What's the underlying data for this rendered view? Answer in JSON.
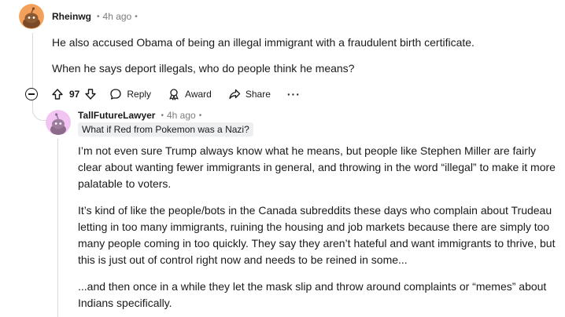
{
  "comment": {
    "author": "Rheinwg",
    "time": "4h ago",
    "paragraphs": [
      "He also accused Obama of being an illegal immigrant with a fraudulent birth certificate.",
      "When he says deport illegals, who do people think he means?"
    ],
    "votes": "97",
    "actions": {
      "reply": "Reply",
      "award": "Award",
      "share": "Share",
      "more": "···"
    }
  },
  "reply": {
    "author": "TallFutureLawyer",
    "time": "4h ago",
    "flair": "What if Red from Pokemon was a Nazi?",
    "paragraphs": [
      "I’m not even sure Trump always know what he means, but people like Stephen Miller are fairly clear about wanting fewer immigrants in general, and throwing in the word “illegal” to make it more palatable to voters.",
      "It’s kind of like the people/bots in the Canada subreddits these days who complain about Trudeau letting in too many immigrants, ruining the housing and job markets because there are simply too many people coming in too quickly. They say they aren’t hateful and want immigrants to thrive, but this is just out of control right now and needs to be reined in some...",
      "...and then once in a while they let the mask slip and throw around complaints or “memes” about Indians specifically."
    ]
  },
  "colors": {
    "avatar_top_bg": "#f3a05a",
    "avatar_reply_bg": "#f2c4f2",
    "text": "#1a1a1b",
    "muted": "#7c7c7c",
    "flair_bg": "#edeff1",
    "thread_line": "#d7dadc"
  },
  "icons": {
    "collapse": "minus-circle-icon",
    "upvote": "arrow-up-icon",
    "downvote": "arrow-down-icon",
    "reply": "speech-bubble-icon",
    "award": "award-ribbon-icon",
    "share": "share-arrow-icon",
    "more": "ellipsis-icon"
  }
}
